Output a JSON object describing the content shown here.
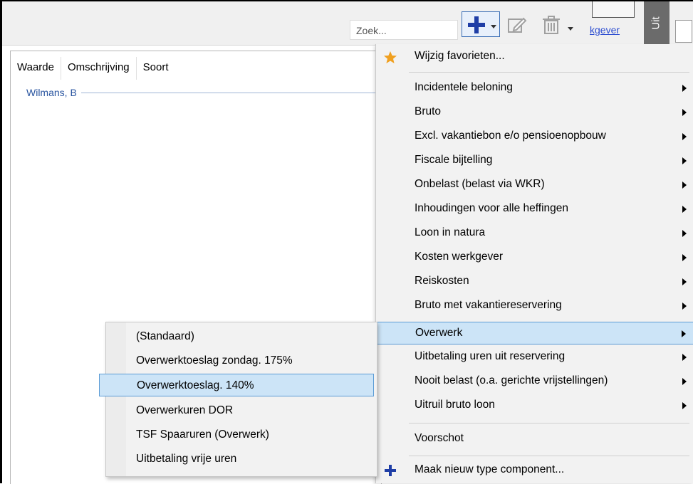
{
  "toolbar": {
    "search_placeholder": "Zoek...",
    "link_text": "kgever",
    "vertical_tab_text": "Uit",
    "icons": [
      "add-icon",
      "edit-icon",
      "delete-icon"
    ]
  },
  "table": {
    "columns": [
      "Waarde",
      "Omschrijving",
      "Soort"
    ],
    "group_label": "Wilmans, B"
  },
  "menu": {
    "favorites": "Wijzig favorieten...",
    "items": [
      "Incidentele beloning",
      "Bruto",
      "Excl. vakantiebon e/o pensioenopbouw",
      "Fiscale bijtelling",
      "Onbelast (belast via WKR)",
      "Inhoudingen voor alle heffingen",
      "Loon in natura",
      "Kosten werkgever",
      "Reiskosten",
      "Bruto met vakantiereservering",
      "Overwerk",
      "Uitbetaling uren uit reservering",
      "Nooit belast (o.a. gerichte vrijstellingen)",
      "Uitruil bruto loon"
    ],
    "highlighted": "Overwerk",
    "advance": "Voorschot",
    "new_type": "Maak nieuw type component..."
  },
  "submenu": {
    "items": [
      "(Standaard)",
      "Overwerktoeslag zondag. 175%",
      "Overwerktoeslag. 140%",
      "Overwerkuren DOR",
      "TSF Spaaruren (Overwerk)",
      "Uitbetaling vrije uren"
    ],
    "highlighted": "Overwerktoeslag. 140%"
  },
  "colors": {
    "accent": "#1f3ea6",
    "highlight_bg": "#cce4f7",
    "highlight_border": "#5b9bd5",
    "group_text": "#2a55a0",
    "star": "#f0a020"
  }
}
